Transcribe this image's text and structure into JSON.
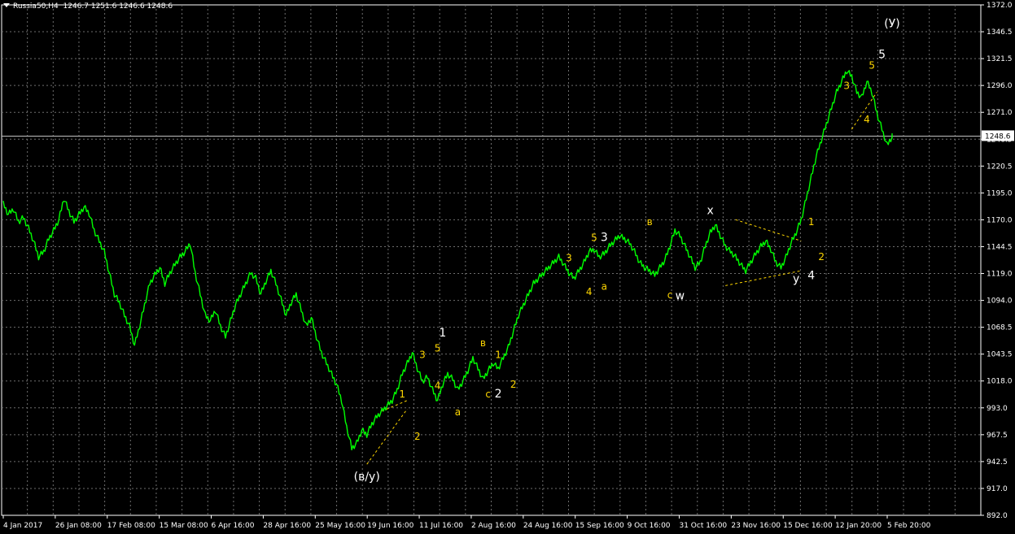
{
  "header": {
    "symbol": "Russia50,H4",
    "ohlc": "1246.7 1251.6 1246.6 1248.6"
  },
  "current_price_label": "1248.6",
  "colors": {
    "background": "#000000",
    "grid": "#6e6e6e",
    "price_line": "#00ff00",
    "axis_text": "#ffffff",
    "wave_yellow": "#ffd700",
    "wave_white": "#ffffff",
    "current_line": "#c0c0c0",
    "channel": "#ffd700"
  },
  "chart_data": {
    "type": "line",
    "title": "",
    "xlabel": "",
    "ylabel": "",
    "ylim": [
      892.0,
      1372.0
    ],
    "y_ticks": [
      "1372.0",
      "1346.5",
      "1321.5",
      "1296.0",
      "1271.0",
      "1246.5",
      "1220.5",
      "1195.0",
      "1170.0",
      "1144.5",
      "1119.0",
      "1094.0",
      "1068.5",
      "1043.5",
      "1018.0",
      "993.0",
      "967.5",
      "942.5",
      "917.0",
      "892.0"
    ],
    "x_ticks": [
      "4 Jan 2017",
      "26 Jan 08:00",
      "17 Feb 08:00",
      "15 Mar 08:00",
      "6 Apr 16:00",
      "28 Apr 16:00",
      "25 May 16:00",
      "19 Jun 16:00",
      "11 Jul 16:00",
      "2 Aug 16:00",
      "24 Aug 16:00",
      "15 Sep 16:00",
      "9 Oct 16:00",
      "31 Oct 16:00",
      "23 Nov 16:00",
      "15 Dec 16:00",
      "12 Jan 20:00",
      "5 Feb 20:00"
    ],
    "grid": true,
    "current_price": 1248.6,
    "series": [
      {
        "values": [
          1185,
          1175,
          1180,
          1168,
          1172,
          1162,
          1150,
          1135,
          1140,
          1152,
          1160,
          1170,
          1190,
          1178,
          1168,
          1175,
          1182,
          1176,
          1160,
          1150,
          1140,
          1120,
          1100,
          1092,
          1080,
          1070,
          1052,
          1070,
          1090,
          1110,
          1118,
          1125,
          1110,
          1120,
          1128,
          1135,
          1140,
          1148,
          1120,
          1100,
          1080,
          1075,
          1085,
          1070,
          1060,
          1075,
          1090,
          1100,
          1110,
          1120,
          1115,
          1100,
          1112,
          1122,
          1110,
          1095,
          1080,
          1092,
          1100,
          1085,
          1070,
          1078,
          1060,
          1045,
          1035,
          1025,
          1015,
          1000,
          975,
          955,
          960,
          972,
          968,
          978,
          985,
          990,
          995,
          1000,
          1010,
          1025,
          1035,
          1045,
          1030,
          1018,
          1022,
          1010,
          1000,
          1015,
          1025,
          1020,
          1010,
          1018,
          1028,
          1040,
          1030,
          1020,
          1028,
          1035,
          1030,
          1040,
          1050,
          1065,
          1080,
          1090,
          1100,
          1110,
          1115,
          1120,
          1125,
          1130,
          1135,
          1128,
          1120,
          1115,
          1122,
          1130,
          1140,
          1142,
          1135,
          1138,
          1145,
          1150,
          1155,
          1152,
          1148,
          1140,
          1130,
          1125,
          1122,
          1118,
          1125,
          1132,
          1145,
          1160,
          1155,
          1145,
          1135,
          1125,
          1130,
          1145,
          1158,
          1165,
          1155,
          1145,
          1140,
          1135,
          1128,
          1122,
          1130,
          1138,
          1145,
          1150,
          1142,
          1130,
          1125,
          1135,
          1148,
          1158,
          1170,
          1190,
          1210,
          1230,
          1245,
          1260,
          1275,
          1290,
          1300,
          1310,
          1305,
          1290,
          1285,
          1300,
          1290,
          1270,
          1255,
          1240,
          1248
        ]
      }
    ]
  },
  "wave_labels": [
    {
      "text": "(У)",
      "color": "white",
      "price": 1351,
      "bar": 176
    },
    {
      "text": "5",
      "color": "white",
      "price": 1322,
      "bar": 174
    },
    {
      "text": "5",
      "color": "yellow",
      "price": 1312,
      "bar": 172
    },
    {
      "text": "3",
      "color": "yellow",
      "price": 1293,
      "bar": 167
    },
    {
      "text": "4",
      "color": "yellow",
      "price": 1261,
      "bar": 171
    },
    {
      "text": "1",
      "color": "yellow",
      "price": 1165,
      "bar": 160
    },
    {
      "text": "2",
      "color": "yellow",
      "price": 1132,
      "bar": 162
    },
    {
      "text": "y",
      "color": "white",
      "price": 1111,
      "bar": 157
    },
    {
      "text": "4",
      "color": "white",
      "price": 1114,
      "bar": 160
    },
    {
      "text": "x",
      "color": "white",
      "price": 1175,
      "bar": 140
    },
    {
      "text": "в",
      "color": "yellow",
      "price": 1165,
      "bar": 128
    },
    {
      "text": "c",
      "color": "yellow",
      "price": 1096,
      "bar": 132
    },
    {
      "text": "w",
      "color": "white",
      "price": 1095,
      "bar": 134
    },
    {
      "text": "5",
      "color": "yellow",
      "price": 1150,
      "bar": 117
    },
    {
      "text": "3",
      "color": "white",
      "price": 1150,
      "bar": 119
    },
    {
      "text": "3",
      "color": "yellow",
      "price": 1131,
      "bar": 112
    },
    {
      "text": "4",
      "color": "yellow",
      "price": 1099,
      "bar": 116
    },
    {
      "text": "a",
      "color": "yellow",
      "price": 1104,
      "bar": 119
    },
    {
      "text": "1",
      "color": "white",
      "price": 1060,
      "bar": 87
    },
    {
      "text": "5",
      "color": "yellow",
      "price": 1046,
      "bar": 86
    },
    {
      "text": "3",
      "color": "yellow",
      "price": 1040,
      "bar": 83
    },
    {
      "text": "4",
      "color": "yellow",
      "price": 1011,
      "bar": 86
    },
    {
      "text": "a",
      "color": "yellow",
      "price": 986,
      "bar": 90
    },
    {
      "text": "в",
      "color": "yellow",
      "price": 1051,
      "bar": 95
    },
    {
      "text": "1",
      "color": "yellow",
      "price": 1040,
      "bar": 98
    },
    {
      "text": "c",
      "color": "yellow",
      "price": 1003,
      "bar": 96
    },
    {
      "text": "2",
      "color": "white",
      "price": 1003,
      "bar": 98
    },
    {
      "text": "2",
      "color": "yellow",
      "price": 1012,
      "bar": 101
    },
    {
      "text": "1",
      "color": "yellow",
      "price": 1003,
      "bar": 79
    },
    {
      "text": "2",
      "color": "yellow",
      "price": 963,
      "bar": 82
    },
    {
      "text": "(в/у)",
      "color": "white",
      "price": 925,
      "bar": 72
    }
  ]
}
